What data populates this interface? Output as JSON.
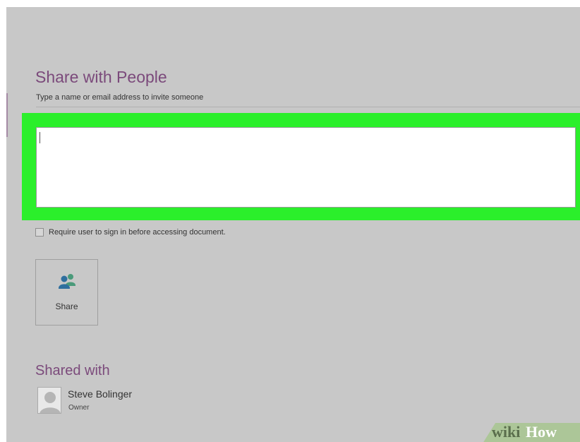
{
  "share_with_people": {
    "title": "Share with People",
    "invite_hint": "Type a name or email address to invite someone",
    "message_area": {
      "value": ""
    }
  },
  "require_signin": {
    "label": "Require user to sign in before accessing document.",
    "checked": false
  },
  "share_button": {
    "label": "Share",
    "icon": "people-icon"
  },
  "shared_with": {
    "title": "Shared with",
    "users": [
      {
        "name": "Steve Bolinger",
        "role": "Owner",
        "avatar_icon": "user-silhouette-icon"
      }
    ]
  },
  "watermark": {
    "text": "wikiHow"
  },
  "colors": {
    "background": "#c8c8c8",
    "heading": "#7b4a7b",
    "highlight": "#2bef2b",
    "share_icon_blue": "#2f6f9e",
    "share_icon_green": "#4a9a7a"
  }
}
